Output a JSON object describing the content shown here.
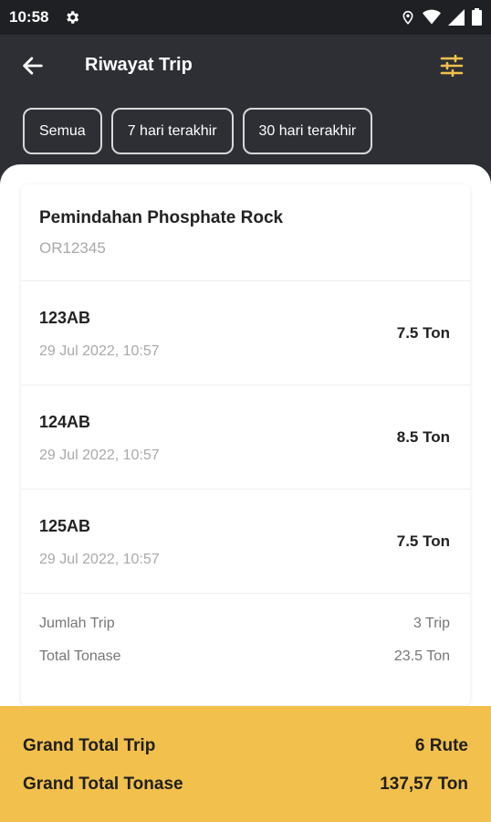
{
  "status_bar": {
    "time": "10:58"
  },
  "app_bar": {
    "title": "Riwayat Trip"
  },
  "filters": [
    {
      "label": "Semua"
    },
    {
      "label": "7 hari terakhir"
    },
    {
      "label": "30 hari terakhir"
    }
  ],
  "order": {
    "title": "Pemindahan Phosphate Rock",
    "code": "OR12345"
  },
  "trips": [
    {
      "plate": "123AB",
      "datetime": "29 Jul 2022, 10:57",
      "tonnage": "7.5 Ton"
    },
    {
      "plate": "124AB",
      "datetime": "29 Jul 2022, 10:57",
      "tonnage": "8.5 Ton"
    },
    {
      "plate": "125AB",
      "datetime": "29 Jul 2022, 10:57",
      "tonnage": "7.5 Ton"
    }
  ],
  "summary": {
    "trip_label": "Jumlah Trip",
    "trip_value": "3 Trip",
    "tonase_label": "Total Tonase",
    "tonase_value": "23.5 Ton"
  },
  "grand_total": {
    "trip_label": "Grand Total Trip",
    "trip_value": "6 Rute",
    "tonase_label": "Grand Total Tonase",
    "tonase_value": "137,57 Ton"
  },
  "colors": {
    "accent": "#f2c04c",
    "dark_bg": "#2d2f34"
  },
  "icons": [
    "gear-icon",
    "location-icon",
    "wifi-icon",
    "signal-icon",
    "battery-icon",
    "back-arrow-icon",
    "filter-sliders-icon"
  ]
}
